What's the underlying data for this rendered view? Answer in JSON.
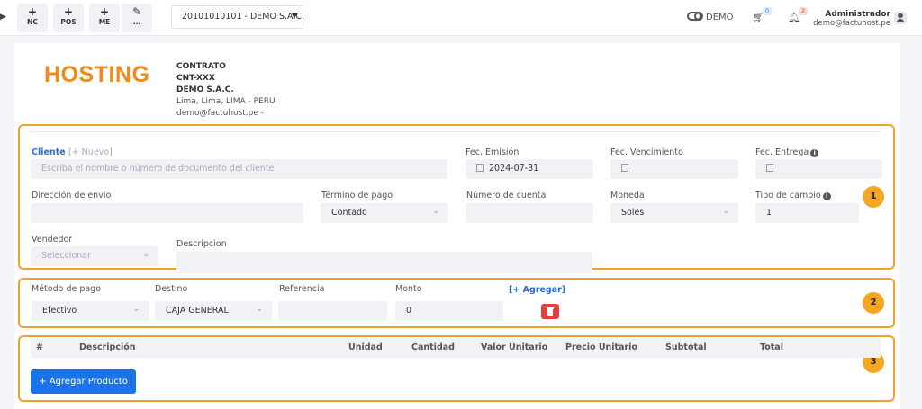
{
  "topbar": {
    "quick_buttons": [
      {
        "icon": "+",
        "label": "NC"
      },
      {
        "icon": "+",
        "label": "POS"
      },
      {
        "icon": "+",
        "label": "ME"
      },
      {
        "icon": "✎",
        "label": "..."
      }
    ],
    "company_select": "20101010101 - DEMO S.A.C.",
    "demo_label": "DEMO",
    "cart_count": "0",
    "notification_count": "2",
    "user_name": "Administrador",
    "user_email": "demo@factuhost.pe"
  },
  "header": {
    "logo_text": "HOSTING",
    "doc_type": "CONTRATO",
    "doc_number": "CNT-XXX",
    "company": "DEMO S.A.C.",
    "address": "Lima, Lima, LIMA - PERU",
    "email": "demo@factuhost.pe -"
  },
  "section1": {
    "badge": "1",
    "cliente_label": "Cliente",
    "nuevo_link": "[+ Nuevo]",
    "cliente_placeholder": "Escriba el nombre o número de documento del cliente",
    "fec_emision_label": "Fec. Emisión",
    "fec_emision_value": "2024-07-31",
    "fec_vencimiento_label": "Fec. Vencimiento",
    "fec_entrega_label": "Fec. Entrega",
    "direccion_label": "Dirección de envio",
    "termino_label": "Término de pago",
    "termino_value": "Contado",
    "cuenta_label": "Número de cuenta",
    "moneda_label": "Moneda",
    "moneda_value": "Soles",
    "tipo_cambio_label": "Tipo de cambio",
    "tipo_cambio_value": "1",
    "vendedor_label": "Vendedor",
    "vendedor_value": "Seleccionar",
    "descripcion_label": "Descripcion"
  },
  "section2": {
    "badge": "2",
    "metodo_label": "Método de pago",
    "metodo_value": "Efectivo",
    "destino_label": "Destino",
    "destino_value": "CAJA GENERAL",
    "referencia_label": "Referencia",
    "monto_label": "Monto",
    "monto_value": "0",
    "agregar_link": "[+ Agregar]"
  },
  "section3": {
    "badge": "3",
    "columns": [
      "#",
      "Descripción",
      "Unidad",
      "Cantidad",
      "Valor Unitario",
      "Precio Unitario",
      "Subtotal",
      "Total"
    ],
    "add_product_button": "+ Agregar Producto"
  },
  "colors": {
    "accent_orange": "#f0a230",
    "brand_blue": "#1a73e8",
    "logo_orange": "#f08a1c",
    "danger": "#e53e3e"
  }
}
